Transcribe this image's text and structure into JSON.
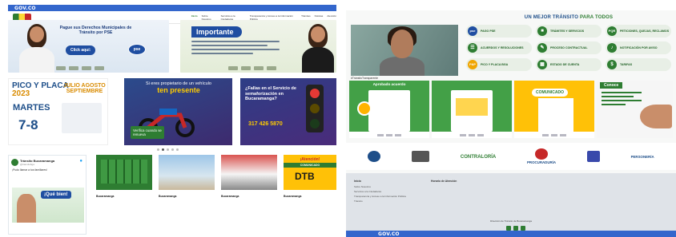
{
  "header": {
    "gov_logo": "GOV.CO",
    "nav_items": [
      "Inicio",
      "Sobre Nosotros",
      "Servicios a la Ciudadanía",
      "Transparencia y Acceso a la Información Pública",
      "Trámites",
      "Noticias",
      "Atención"
    ]
  },
  "banners": {
    "pse": {
      "title": "Pague sus Derechos Municipales de Tránsito por PSE",
      "cta": "Click aquí:",
      "badge": "pse"
    },
    "importante": {
      "title": "Importante"
    }
  },
  "cards": {
    "pico": {
      "title": "PICO Y PLACA",
      "year": "2023",
      "months": "JULIO AGOSTO SEPTIEMBRE",
      "day": "MARTES",
      "digits": "7-8"
    },
    "moto": {
      "line1": "Si eres propietario de un vehículo",
      "highlight": "ten presente",
      "note": "Verifica cuando se renueva"
    },
    "semaforo": {
      "title": "¿Fallas en el Servicio de semaforización en Bucaramanga?",
      "phone": "317 426 5870"
    }
  },
  "carousel": {
    "count": 5,
    "active": 2
  },
  "twitter": {
    "name": "Tránsito Bucaramanga",
    "handle": "@transitobga",
    "text": "¡Pudo llamar a tus familiares!",
    "badge": "¡Qué bien!"
  },
  "news": [
    {
      "title": "Bucaramanga",
      "body": ""
    },
    {
      "title": "Bucaramanga",
      "body": ""
    },
    {
      "title": "Bucaramanga",
      "body": ""
    },
    {
      "title": "Bucaramanga",
      "body": "",
      "attention": "¡Atención!",
      "comunicado": "COMUNICADO",
      "dtb": "DTB"
    }
  ],
  "right": {
    "section_title_part1": "UN MEJOR TRÁNSITO",
    "section_title_part2": "PARA TODOS",
    "video_caption": "#TránsitoTransparente",
    "services": [
      {
        "label": "PAGO PSE",
        "icon": "pse",
        "style": "blue"
      },
      {
        "label": "TRÁMITES Y SERVICIOS",
        "icon": "car-icon",
        "style": "green"
      },
      {
        "label": "PETICIONES, QUEJAS, RECLAMOS",
        "icon": "PQR",
        "style": "green"
      },
      {
        "label": "ACUERDOS Y RESOLUCIONES",
        "icon": "document-icon",
        "style": "green"
      },
      {
        "label": "PROCESO CONTRACTUAL",
        "icon": "contract-icon",
        "style": "green"
      },
      {
        "label": "NOTIFICACIÓN POR AVISO",
        "icon": "bell-icon",
        "style": "green"
      },
      {
        "label": "PICO Y PLACA BGA",
        "icon": "P&P",
        "style": "orange"
      },
      {
        "label": "ESTADO DE CUENTA",
        "icon": "account-icon",
        "style": "green"
      },
      {
        "label": "TARIFAS",
        "icon": "dollar-icon",
        "style": "green"
      }
    ],
    "promos": [
      {
        "label": "Aprobado acuerdo"
      },
      {
        "label": ""
      },
      {
        "label": "COMUNICADO"
      },
      {
        "label": "Conoce"
      }
    ],
    "partners": [
      "",
      "",
      "CONTRALORÍA",
      "PROCURADURÍA",
      "",
      "PERSONERÍA"
    ],
    "footer": {
      "col1_title": "Inicio",
      "col1_items": [
        "Sobre Nosotros",
        "Servicios a la Ciudadanía",
        "Transparencia y Acceso a la Información Pública",
        "Tránsito"
      ],
      "col2_title": "Horario de Atención",
      "col3_title": "",
      "col4_title": "",
      "copyright": "Dirección de Tránsito de Bucaramanga"
    }
  },
  "colors": {
    "gov_blue": "#3366cc",
    "brand_green": "#2e7d32",
    "accent_yellow": "#ffc107",
    "navy": "#1d4e89"
  }
}
